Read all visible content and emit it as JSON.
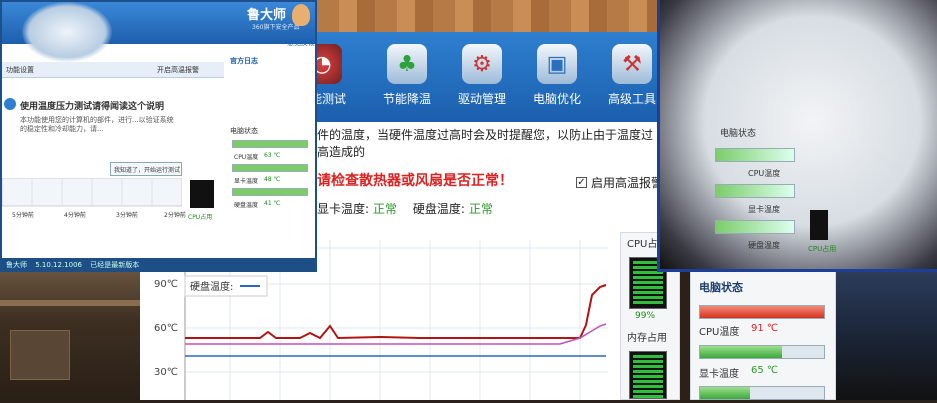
{
  "main": {
    "nav": [
      {
        "label": "性能测试",
        "icon": "speedometer-icon"
      },
      {
        "label": "节能降温",
        "icon": "clover-icon"
      },
      {
        "label": "驱动管理",
        "icon": "chip-icon"
      },
      {
        "label": "电脑优化",
        "icon": "monitor-icon"
      },
      {
        "label": "高级工具",
        "icon": "toolbox-icon"
      }
    ],
    "info_text": "件的温度，当硬件温度过高时会及时提醒您，以防止由于温度过高造成的",
    "warning": "请检查散热器或风扇是否正常！",
    "alarm_checkbox": "启用高温报警",
    "gpu_temp_label": "显卡温度:",
    "gpu_temp_value": "正常",
    "disk_temp_label": "硬盘温度:",
    "disk_temp_value": "正常",
    "chart": {
      "y_ticks": [
        "90℃",
        "60℃",
        "30℃"
      ],
      "legend": "硬盘温度:"
    },
    "cpu_usage_label": "CPU占用",
    "cpu_usage_value": "99%",
    "mem_usage_label": "内存占用",
    "status": {
      "title": "电脑状态",
      "cpu_label": "CPU温度",
      "cpu_value": "91 ℃",
      "gpu_label": "显卡温度",
      "gpu_value": "65 ℃"
    }
  },
  "win2": {
    "logo": "鲁大师",
    "logo_sub": "360旗下安全产品",
    "feedback": "意见反馈",
    "panel_title": "官方日志",
    "section": "功能设置",
    "checkbox": "开启高温报警",
    "heading": "使用温度压力测试请得闻读这个说明",
    "desc": "本功能使用您的计算机的部件，进行...以验证系统的稳定性和冷却能力，请...",
    "btn_label": "我知道了，开始运行测试",
    "status_left": "鲁大师",
    "status_ver": "5.10.12.1006",
    "status_mid": "已经是最新版本",
    "side_title": "电脑状态",
    "side_items": [
      "CPU温度",
      "显卡温度",
      "硬盘温度"
    ],
    "side_vals": [
      "63 ℃",
      "48 ℃",
      "41 ℃"
    ],
    "x_ticks": [
      "5分钟前",
      "4分钟前",
      "3分钟前",
      "2分钟前"
    ],
    "meter_label": "CPU占用"
  },
  "win3": {
    "labels": [
      "电脑状态",
      "CPU温度",
      "显卡温度",
      "硬盘温度"
    ],
    "meter": "CPU占用"
  }
}
